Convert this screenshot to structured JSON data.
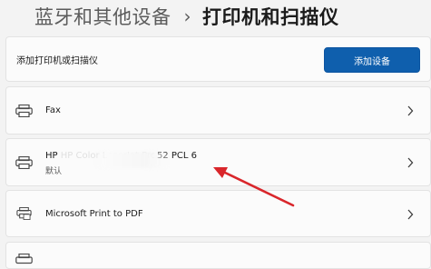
{
  "header": {
    "breadcrumb_parent": "蓝牙和其他设备",
    "separator": "›",
    "breadcrumb_current": "打印机和扫描仪"
  },
  "add_section": {
    "label": "添加打印机或扫描仪",
    "button_label": "添加设备"
  },
  "printers": [
    {
      "name": "Fax",
      "subtitle": ""
    },
    {
      "name": "HP Color LaserJet Pro M252 PCL 6",
      "name_visible_left": "HP",
      "name_visible_right": "52 PCL 6",
      "subtitle": "默认"
    },
    {
      "name": "Microsoft Print to PDF",
      "subtitle": ""
    }
  ],
  "annotation": {
    "arrow_color": "#d9262b"
  },
  "colors": {
    "accent": "#0f5fad",
    "background": "#f3f3f3",
    "card": "#fbfbfb"
  },
  "icons": {
    "printer": "printer-icon",
    "pdf_printer": "pdf-printer-icon",
    "chevron": "chevron-right-icon"
  }
}
